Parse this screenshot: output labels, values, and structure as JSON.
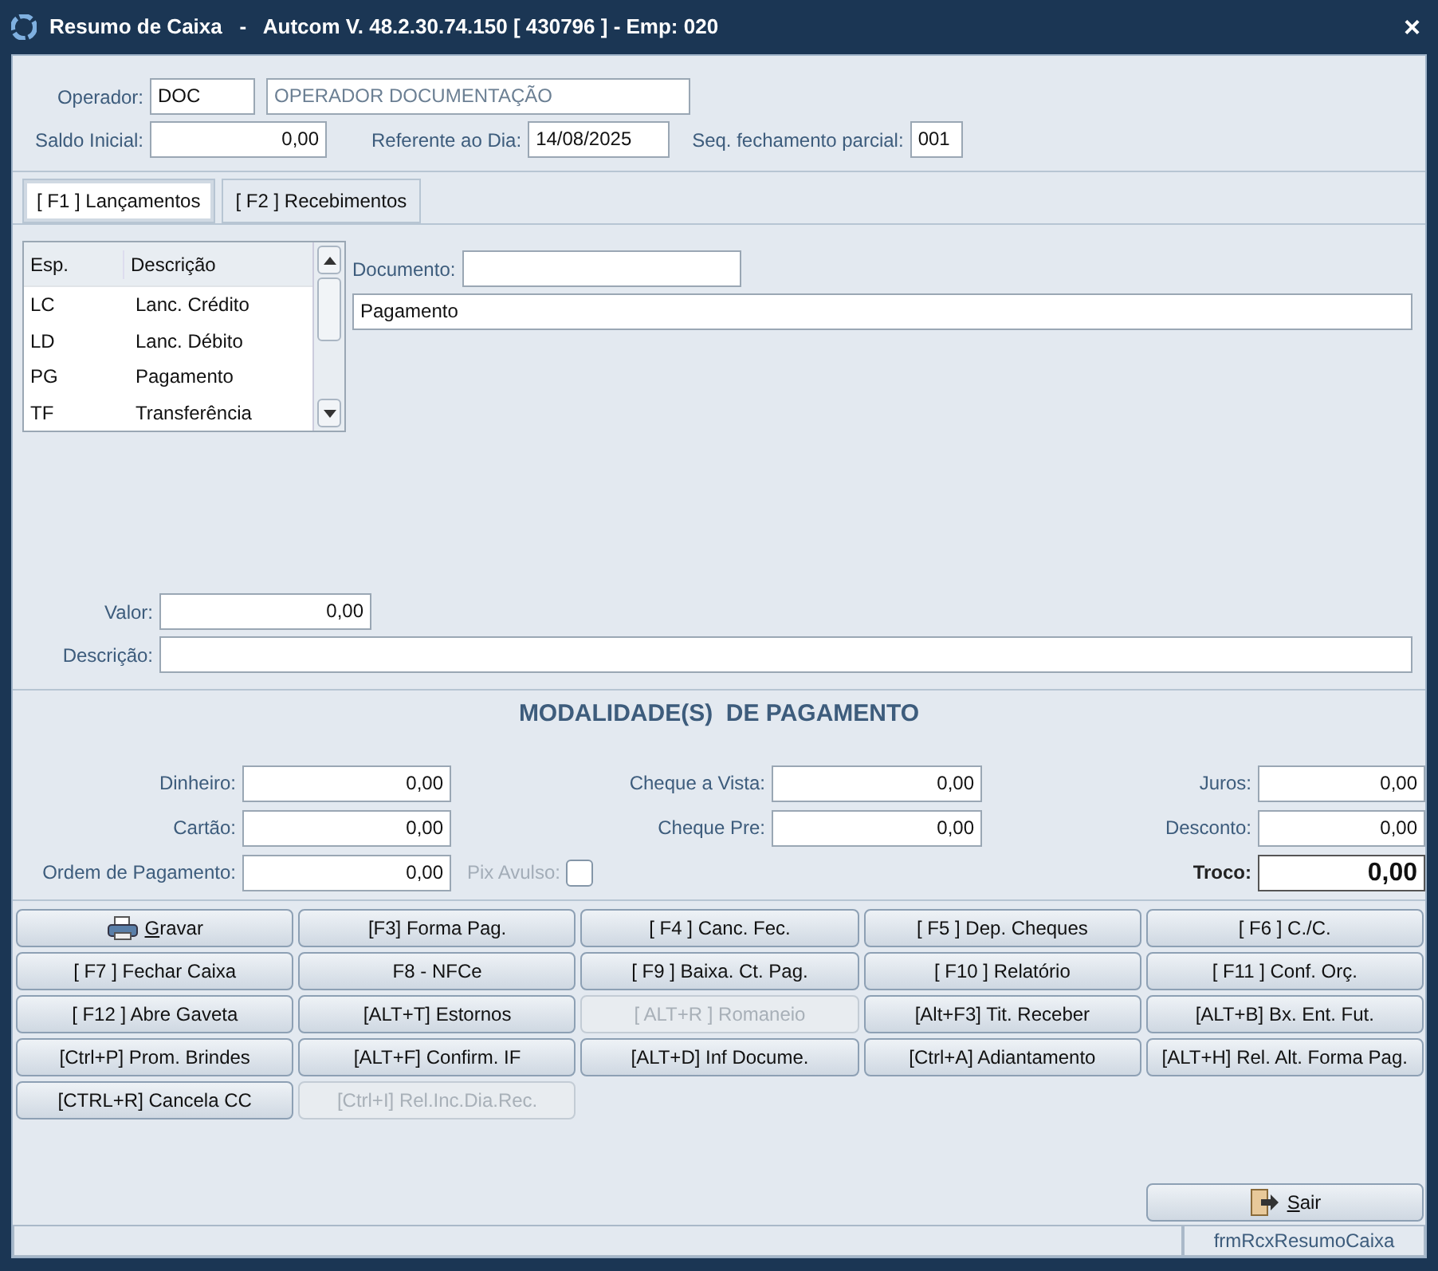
{
  "window": {
    "title": "Resumo de Caixa   -   Autcom V. 48.2.30.74.150 [ 430796 ] - Emp: 020",
    "close": "×"
  },
  "header": {
    "operator": {
      "label": "Operador:",
      "code": "DOC",
      "name": "OPERADOR DOCUMENTAÇÃO"
    },
    "opening_balance": {
      "label": "Saldo Inicial:",
      "value": "0,00"
    },
    "reference_day": {
      "label": "Referente ao Dia:",
      "value": "14/08/2025"
    },
    "partial_sequence": {
      "label": "Seq. fechamento parcial:",
      "value": "001"
    }
  },
  "tabs": [
    {
      "label": "[ F1 ] Lançamentos",
      "selected": true
    },
    {
      "label": "[ F2 ] Recebimentos",
      "selected": false
    }
  ],
  "entry_types": {
    "columns": [
      "Esp.",
      "Descrição"
    ],
    "rows": [
      {
        "code": "LC",
        "description": "Lanc. Crédito",
        "selected": false
      },
      {
        "code": "LD",
        "description": "Lanc. Débito",
        "selected": false
      },
      {
        "code": "PG",
        "description": "Pagamento",
        "selected": false
      },
      {
        "code": "TF",
        "description": "Transferência",
        "selected": false
      }
    ]
  },
  "document": {
    "label": "Documento:"
  },
  "entry_type_field": {
    "value": "Pagamento"
  },
  "amount": {
    "label": "Valor:",
    "value": "0,00"
  },
  "description": {
    "label": "Descrição:"
  },
  "payment": {
    "title": "MODALIDADE(S)  DE PAGAMENTO",
    "columns": [
      [
        {
          "label": "Dinheiro:",
          "value": "0,00"
        },
        {
          "label": "Cartão:",
          "value": "0,00"
        },
        {
          "label": "Ordem de Pagamento:",
          "value": "0,00"
        }
      ],
      [
        {
          "label": "Cheque a Vista:",
          "value": "0,00"
        },
        {
          "label": "Cheque Pre:",
          "value": "0,00"
        }
      ],
      [
        {
          "label": "Juros:",
          "value": "0,00"
        },
        {
          "label": "Desconto:",
          "value": "0,00"
        },
        {
          "label": "Troco:",
          "value": "0,00",
          "kind": "total"
        }
      ]
    ],
    "pix": {
      "label": "Pix Avulso:",
      "checked": false,
      "disabled": true
    }
  },
  "buttons": [
    {
      "label": "Gravar",
      "kind": "iconic",
      "disabled": false
    },
    {
      "label": "[F3] Forma Pag.",
      "kind": "text",
      "disabled": false
    },
    {
      "label": "[ F4 ] Canc. Fec.",
      "kind": "text",
      "disabled": false
    },
    {
      "label": "[ F5 ] Dep. Cheques",
      "kind": "text",
      "disabled": false
    },
    {
      "label": "[ F6 ] C./C.",
      "kind": "text",
      "disabled": false
    },
    {
      "label": "[ F7 ] Fechar Caixa",
      "kind": "text",
      "disabled": false
    },
    {
      "label": "F8 - NFCe",
      "kind": "text",
      "disabled": false
    },
    {
      "label": "[ F9 ] Baixa. Ct. Pag.",
      "kind": "text",
      "disabled": false
    },
    {
      "label": "[ F10 ] Relatório",
      "kind": "text",
      "disabled": false
    },
    {
      "label": "[ F11 ] Conf. Orç.",
      "kind": "text",
      "disabled": false
    },
    {
      "label": "[ F12 ] Abre Gaveta",
      "kind": "text",
      "disabled": false
    },
    {
      "label": "[ALT+T] Estornos",
      "kind": "text",
      "disabled": false
    },
    {
      "label": "[ ALT+R ] Romaneio",
      "kind": "text",
      "disabled": true
    },
    {
      "label": "[Alt+F3] Tit. Receber",
      "kind": "text",
      "disabled": false
    },
    {
      "label": "[ALT+B] Bx. Ent. Fut.",
      "kind": "text",
      "disabled": false
    },
    {
      "label": "[Ctrl+P] Prom. Brindes",
      "kind": "text",
      "disabled": false
    },
    {
      "label": "[ALT+F] Confirm. IF",
      "kind": "text",
      "disabled": false
    },
    {
      "label": "[ALT+D] Inf Docume.",
      "kind": "text",
      "disabled": false
    },
    {
      "label": "[Ctrl+A] Adiantamento",
      "kind": "text",
      "disabled": false
    },
    {
      "label": "[ALT+H] Rel. Alt. Forma Pag.",
      "kind": "text",
      "disabled": false
    },
    {
      "label": "[CTRL+R] Cancela CC",
      "kind": "text",
      "disabled": false
    },
    {
      "label": "[Ctrl+I] Rel.Inc.Dia.Rec.",
      "kind": "text",
      "disabled": true
    }
  ],
  "exit_button": {
    "label": "Sair"
  },
  "status_bar": {
    "form_name": "frmRcxResumoCaixa"
  }
}
